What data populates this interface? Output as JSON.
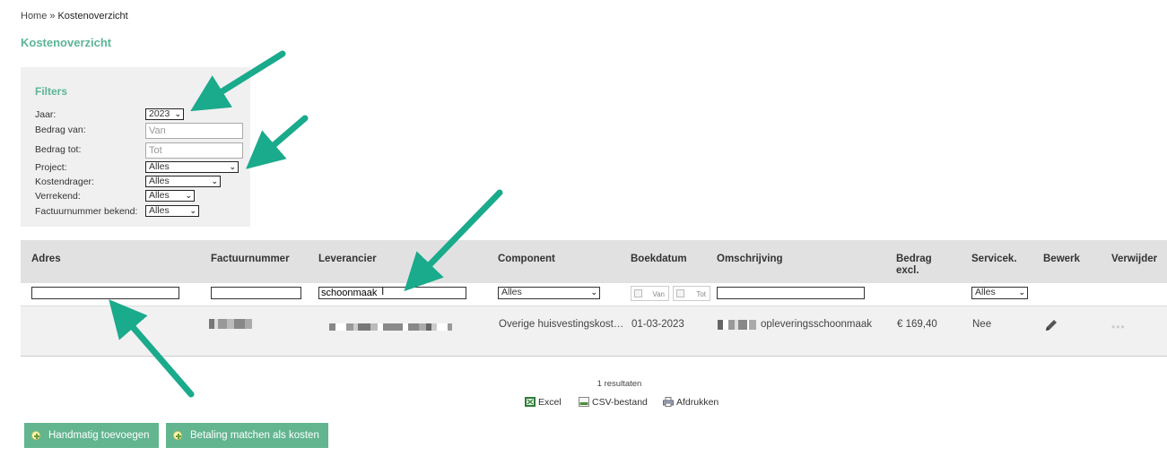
{
  "breadcrumb": {
    "home": "Home",
    "separator": "»",
    "current": "Kostenoverzicht"
  },
  "page_title": "Kostenoverzicht",
  "filters": {
    "heading": "Filters",
    "jaar": {
      "label": "Jaar:",
      "value": "2023"
    },
    "bedrag_van": {
      "label": "Bedrag van:",
      "placeholder": "Van"
    },
    "bedrag_tot": {
      "label": "Bedrag tot:",
      "placeholder": "Tot"
    },
    "project": {
      "label": "Project:",
      "value": "Alles"
    },
    "kostendrager": {
      "label": "Kostendrager:",
      "value": "Alles"
    },
    "verrekend": {
      "label": "Verrekend:",
      "value": "Alles"
    },
    "factuurnummer_bekend": {
      "label": "Factuurnummer bekend:",
      "value": "Alles"
    }
  },
  "table": {
    "headers": {
      "adres": "Adres",
      "factuurnummer": "Factuurnummer",
      "leverancier": "Leverancier",
      "component": "Component",
      "boekdatum": "Boekdatum",
      "omschrijving": "Omschrijving",
      "bedrag_line1": "Bedrag",
      "bedrag_line2": "excl.",
      "servicek": "Servicek.",
      "bewerk": "Bewerk",
      "verwijder": "Verwijder"
    },
    "filter_row": {
      "adres": "",
      "factuurnummer": "",
      "leverancier": "schoonmaak",
      "component": "Alles",
      "datum_van": "Van",
      "datum_tot": "Tot",
      "omschrijving": "",
      "servicek": "Alles"
    },
    "rows": [
      {
        "component": "Overige huisvestingskost…",
        "boekdatum": "01-03-2023",
        "omschrijving_suffix": "opleveringsschoonmaak",
        "bedrag": "€ 169,40",
        "servicek": "Nee"
      }
    ]
  },
  "results_text": "1 resultaten",
  "exports": {
    "excel": "Excel",
    "csv": "CSV-bestand",
    "print": "Afdrukken"
  },
  "buttons": {
    "handmatig": "Handmatig toevoegen",
    "betaling": "Betaling matchen als kosten"
  },
  "colors": {
    "accent": "#5cb596",
    "button": "#62b58f",
    "arrow": "#1aaa8c"
  }
}
